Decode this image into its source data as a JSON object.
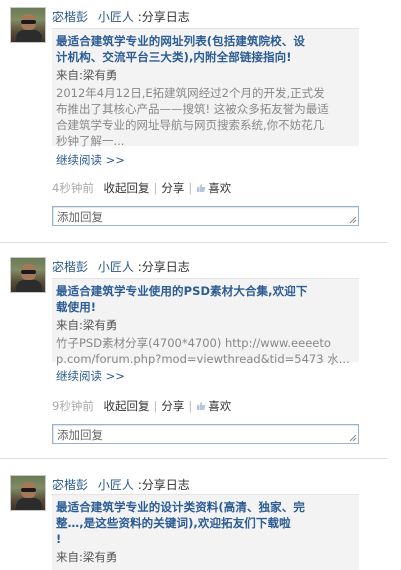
{
  "posts": [
    {
      "author": "宓楷彭",
      "nickname": "小匠人",
      "action": ":分享日志",
      "title": "最适合建筑学专业的网址列表(包括建筑院校、设计机构、交流平台三大类),内附全部链接指向!",
      "title_lines": [
        "最适合建筑学专业的网址列表(包括建筑院校、设",
        "计机构、交流平台三大类),内附全部链接指向!"
      ],
      "source_label": "来自:",
      "source_name": "梁有勇",
      "excerpt_lines": [
        "2012年4月12日,E拓建筑网经过2个月的开发,正式发",
        "布推出了其核心产品——搜筑! 这被众多拓友誉为最适",
        "合建筑学专业的网址导航与网页搜索系统,你不妨花几",
        "秒钟了解一..."
      ],
      "read_more": "继续阅读 >>",
      "time": "4秒钟前",
      "reply_label": "收起回复",
      "share_label": "分享",
      "like_label": "喜欢",
      "reply_placeholder": "添加回复"
    },
    {
      "author": "宓楷彭",
      "nickname": "小匠人",
      "action": ":分享日志",
      "title_lines": [
        "最适合建筑学专业使用的PSD素材大合集,欢迎下",
        "载使用!"
      ],
      "source_label": "来自:",
      "source_name": "梁有勇",
      "excerpt_lines": [
        "竹子PSD素材分享(4700*4700) http://www.eeeeto",
        "p.com/forum.php?mod=viewthread&tid=5473 水..."
      ],
      "read_more": "继续阅读 >>",
      "time": "9秒钟前",
      "reply_label": "收起回复",
      "share_label": "分享",
      "like_label": "喜欢",
      "reply_placeholder": "添加回复"
    },
    {
      "author": "宓楷彭",
      "nickname": "小匠人",
      "action": ":分享日志",
      "title_lines": [
        "最适合建筑学专业的设计类资料(高清、独家、完",
        "整…,是这些资料的关键词),欢迎拓友们下载啦",
        "!"
      ],
      "source_label": "来自:",
      "source_name": "梁有勇"
    }
  ],
  "colors": {
    "link": "#2c5c94",
    "card_bg": "#f3f3f3",
    "reply_border": "#9db3c9"
  }
}
